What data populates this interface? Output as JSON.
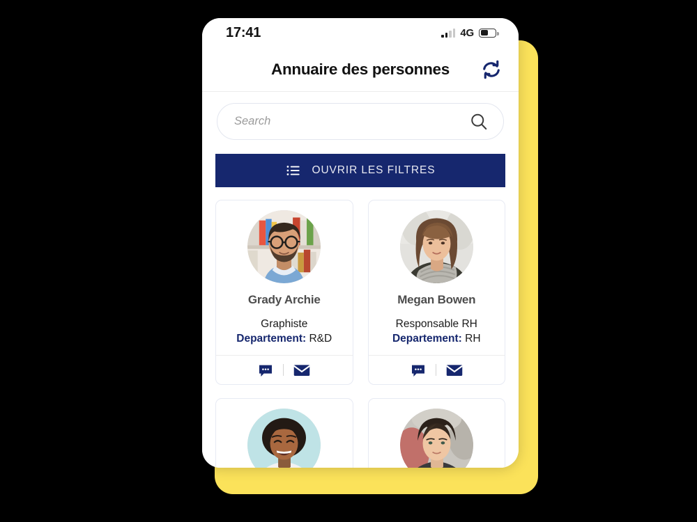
{
  "status_bar": {
    "time": "17:41",
    "network": "4G",
    "signal_icon": "signal-bars-icon",
    "battery_icon": "battery-icon",
    "battery_level_percent": 50
  },
  "header": {
    "title": "Annuaire des personnes",
    "refresh_icon": "refresh-icon"
  },
  "search": {
    "placeholder": "Search",
    "value": "",
    "icon": "search-icon"
  },
  "filters": {
    "label": "OUVRIR LES FILTRES",
    "icon": "list-filter-icon"
  },
  "colors": {
    "brand_navy": "#16276E",
    "accent_yellow": "#FBE25A",
    "card_border": "#e7eaf3",
    "name_gray": "#4d4d4d"
  },
  "card_actions": {
    "chat_icon": "chat-bubble-icon",
    "mail_icon": "envelope-icon"
  },
  "people": [
    {
      "name": "Grady Archie",
      "role": "Graphiste",
      "dept_label": "Departement:",
      "dept_value": "R&D",
      "avatar": "man-glasses-beard-bookshelf"
    },
    {
      "name": "Megan Bowen",
      "role": "Responsable RH",
      "dept_label": "Departement:",
      "dept_value": "RH",
      "avatar": "woman-long-hair-scarf"
    }
  ],
  "people_partial": [
    {
      "avatar": "woman-curly-hair-smiling-teal-background"
    },
    {
      "avatar": "woman-dark-hair-tied-back"
    }
  ]
}
